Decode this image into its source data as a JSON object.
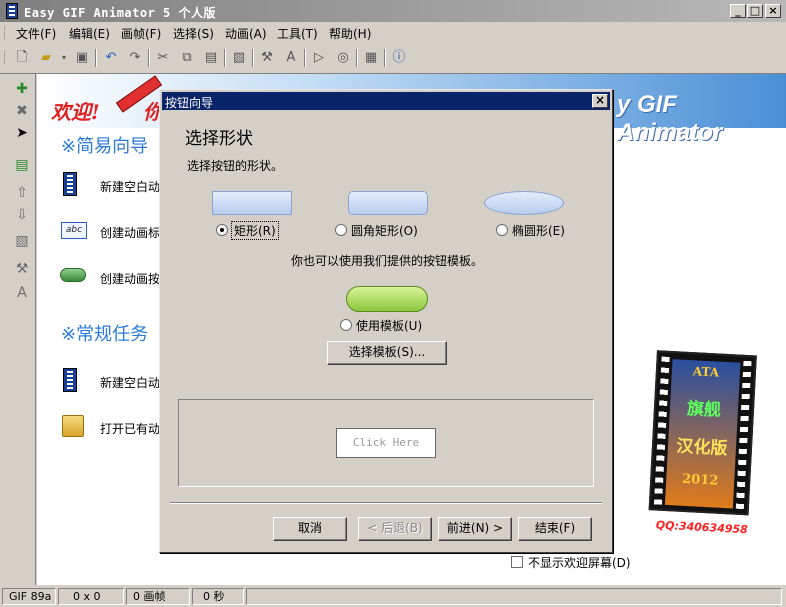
{
  "app": {
    "title": "Easy GIF Animator 5 个人版"
  },
  "window_controls": {
    "minimize": "_",
    "maximize": "□",
    "close": "×"
  },
  "menu": {
    "items": [
      {
        "label": "文件(F)"
      },
      {
        "label": "编辑(E)"
      },
      {
        "label": "画帧(F)"
      },
      {
        "label": "选择(S)"
      },
      {
        "label": "动画(A)"
      },
      {
        "label": "工具(T)"
      },
      {
        "label": "帮助(H)"
      }
    ]
  },
  "toolbar": {
    "icons": [
      "new-icon",
      "open-icon",
      "save-icon",
      "undo-icon",
      "redo-icon",
      "cut-icon",
      "copy-icon",
      "paste-icon",
      "image-icon",
      "wand-icon",
      "text-icon",
      "play-icon",
      "preview-icon",
      "export-icon",
      "help-icon"
    ]
  },
  "welcome": {
    "banner_welcome": "欢迎!",
    "banner_welcome_more": "你",
    "banner_brand": "y GIF Animator",
    "easy_guide_title": "※简易向导",
    "tasks_title": "※常规任务",
    "easy_items": [
      {
        "label": "新建空白动"
      },
      {
        "label": "创建动画标"
      },
      {
        "label": "创建动画按"
      }
    ],
    "task_items": [
      {
        "label": "新建空白动"
      },
      {
        "label": "打开已有动"
      }
    ],
    "no_show_label": "不显示欢迎屏幕(D)",
    "badge": {
      "top": "ATA",
      "mid1": "旗舰",
      "mid2": "汉化版",
      "year": "2012",
      "qq": "QQ:340634958"
    }
  },
  "status": {
    "format": "GIF 89a",
    "size": "0 x 0",
    "frames": "0 画帧",
    "seconds": "0 秒"
  },
  "dialog": {
    "title": "按钮向导",
    "close": "×",
    "heading": "选择形状",
    "subheading": "选择按钮的形状。",
    "shapes": [
      {
        "label": "矩形(R)",
        "selected": true
      },
      {
        "label": "圆角矩形(O)",
        "selected": false
      },
      {
        "label": "椭圆形(E)",
        "selected": false
      }
    ],
    "template_note": "你也可以使用我们提供的按钮模板。",
    "use_template_label": "使用模板(U)",
    "use_template_selected": false,
    "choose_template_button": "选择模板(S)...",
    "preview_button_text": "Click Here",
    "buttons": {
      "cancel": "取消",
      "back": "< 后退(B)",
      "next": "前进(N) >",
      "finish": "结束(F)"
    }
  },
  "colors": {
    "dialog_title_bg": "#0a246a",
    "section_blue": "#2a7ad8",
    "welcome_red": "#e02020",
    "template_green": "#8cc83c"
  }
}
